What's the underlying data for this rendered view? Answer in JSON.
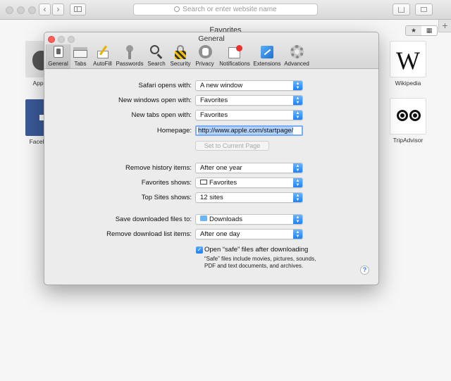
{
  "browser": {
    "url_placeholder": "Search or enter website name",
    "favorites_title": "Favorites",
    "view_toggle": {
      "star": "★",
      "grid": "▦"
    },
    "new_tab": "+"
  },
  "favorites": [
    {
      "label": "App",
      "visible_label": "App"
    },
    {
      "label": "Facel",
      "visible_label": "Facel"
    },
    {
      "label": "Wikipedia",
      "letter": "W"
    },
    {
      "label": "TripAdvisor"
    }
  ],
  "prefs": {
    "title": "General",
    "tabs": [
      {
        "label": "General",
        "icon": "general-icon"
      },
      {
        "label": "Tabs",
        "icon": "tabs-icon"
      },
      {
        "label": "AutoFill",
        "icon": "autofill-icon"
      },
      {
        "label": "Passwords",
        "icon": "key-icon"
      },
      {
        "label": "Search",
        "icon": "search-icon"
      },
      {
        "label": "Security",
        "icon": "lock-icon"
      },
      {
        "label": "Privacy",
        "icon": "hand-icon"
      },
      {
        "label": "Notifications",
        "icon": "notifications-icon"
      },
      {
        "label": "Extensions",
        "icon": "puzzle-icon"
      },
      {
        "label": "Advanced",
        "icon": "gear-icon"
      }
    ],
    "safari_opens_with": {
      "label": "Safari opens with:",
      "value": "A new window"
    },
    "new_windows_open_with": {
      "label": "New windows open with:",
      "value": "Favorites"
    },
    "new_tabs_open_with": {
      "label": "New tabs open with:",
      "value": "Favorites"
    },
    "homepage": {
      "label": "Homepage:",
      "value": "http://www.apple.com/startpage/"
    },
    "set_current_page": "Set to Current Page",
    "remove_history": {
      "label": "Remove history items:",
      "value": "After one year"
    },
    "favorites_shows": {
      "label": "Favorites shows:",
      "value": "Favorites"
    },
    "top_sites_shows": {
      "label": "Top Sites shows:",
      "value": "12 sites"
    },
    "save_downloads": {
      "label": "Save downloaded files to:",
      "value": "Downloads"
    },
    "remove_download_list": {
      "label": "Remove download list items:",
      "value": "After one day"
    },
    "open_safe_files": {
      "label": "Open “safe” files after downloading",
      "checked": true
    },
    "safe_files_note": "“Safe” files include movies, pictures, sounds, PDF and text documents, and archives.",
    "help": "?"
  }
}
